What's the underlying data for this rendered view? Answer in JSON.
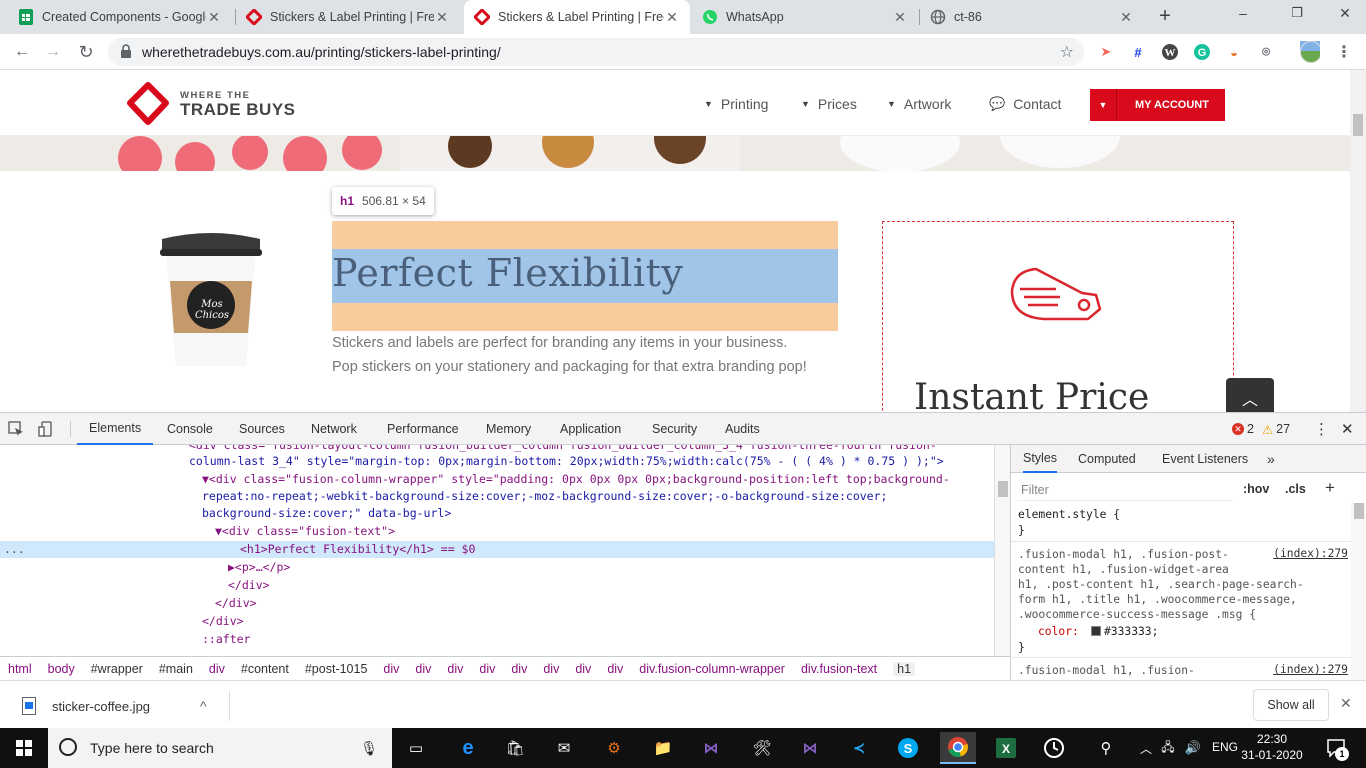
{
  "browser": {
    "tabs": [
      {
        "title": "Created Components - Google",
        "favicon": "google-sheets-icon",
        "active": false
      },
      {
        "title": "Stickers & Label Printing | Free",
        "favicon": "wttb-logo-icon",
        "active": false
      },
      {
        "title": "Stickers & Label Printing | Free",
        "favicon": "wttb-logo-icon",
        "active": true
      },
      {
        "title": "WhatsApp",
        "favicon": "whatsapp-icon",
        "active": false
      },
      {
        "title": "ct-86",
        "favicon": "globe-icon",
        "active": false
      }
    ],
    "new_tab": "+",
    "window_controls": {
      "minimize": "–",
      "maximize": "❐",
      "close": "✕"
    },
    "url": "wherethetradebuys.com.au/printing/stickers-label-printing/"
  },
  "site": {
    "logo_top": "WHERE THE",
    "logo_bottom": "TRADE BUYS",
    "nav": [
      "Printing",
      "Prices",
      "Artwork",
      "Contact"
    ],
    "account_button": "MY ACCOUNT",
    "tooltip": {
      "tag": "h1",
      "dims": "506.81 × 54"
    },
    "heading": "Perfect Flexibility",
    "paragraph_lines": [
      "Stickers and labels are perfect for branding any items in your business.",
      "Pop stickers on your stationery and packaging for that extra branding pop!"
    ],
    "cup_text": "Mos Chicos",
    "price_title": "Instant Price"
  },
  "devtools": {
    "tabs": [
      "Elements",
      "Console",
      "Sources",
      "Network",
      "Performance",
      "Memory",
      "Application",
      "Security",
      "Audits"
    ],
    "errors": "2",
    "warnings": "27",
    "dom_lines": [
      {
        "text": "<div class=\"fusion-layout-column fusion_builder_column fusion_builder_column_3_4 fusion-three-fourth fusion-",
        "indent": 189
      },
      {
        "text": "column-last 3_4\" style=\"margin-top: 0px;margin-bottom: 20px;width:75%;width:calc(75% - ( ( 4% ) * 0.75 ) );\">",
        "indent": 189
      },
      {
        "text": "▼<div class=\"fusion-column-wrapper\" style=\"padding: 0px 0px 0px 0px;background-position:left top;background-",
        "indent": 202
      },
      {
        "text": "repeat:no-repeat;-webkit-background-size:cover;-moz-background-size:cover;-o-background-size:cover;",
        "indent": 202
      },
      {
        "text": "background-size:cover;\" data-bg-url>",
        "indent": 202
      },
      {
        "text": "▼<div class=\"fusion-text\">",
        "indent": 215
      },
      {
        "text": "<h1>Perfect Flexibility</h1> == $0",
        "indent": 240
      },
      {
        "text": "▶<p>…</p>",
        "indent": 228
      },
      {
        "text": "</div>",
        "indent": 228
      },
      {
        "text": "</div>",
        "indent": 215
      },
      {
        "text": "</div>",
        "indent": 202
      },
      {
        "text": "::after",
        "indent": 202
      }
    ],
    "selected_marker": "...",
    "breadcrumbs": [
      "html",
      "body",
      "#wrapper",
      "#main",
      "div",
      "#content",
      "#post-1015",
      "div",
      "div",
      "div",
      "div",
      "div",
      "div",
      "div",
      "div",
      "div.fusion-column-wrapper",
      "div.fusion-text",
      "h1"
    ],
    "styles_tabs": [
      "Styles",
      "Computed",
      "Event Listeners",
      "»"
    ],
    "filter_placeholder": "Filter",
    "hov": ":hov",
    "cls": ".cls",
    "plus": "+",
    "rules": {
      "element_style": "element.style {",
      "close_brace": "}",
      "selector_lines": [
        ".fusion-modal h1, .fusion-post-",
        "content h1, .fusion-widget-area",
        "h1, .post-content h1, .search-page-search-",
        "form h1, .title h1, .woocommerce-message,",
        ".woocommerce-success-message .msg {"
      ],
      "prop": "color:",
      "value": "#333333;",
      "color_swatch": "#333333",
      "source": "(index):279",
      "next_selector": ".fusion-modal h1, .fusion-",
      "next_source": "(index):279"
    }
  },
  "download": {
    "filename": "sticker-coffee.jpg",
    "show_all": "Show all",
    "chevron": "^",
    "close": "✕"
  },
  "taskbar": {
    "search_placeholder": "Type here to search",
    "language": "ENG",
    "time": "22:30",
    "date": "31-01-2020",
    "notification_count": "1"
  },
  "colors": {
    "brand_red": "#d90a1b",
    "highlight_blue": "#a0c5e8",
    "highlight_orange": "#f9cc9d",
    "link_blue": "#1a73e8"
  }
}
